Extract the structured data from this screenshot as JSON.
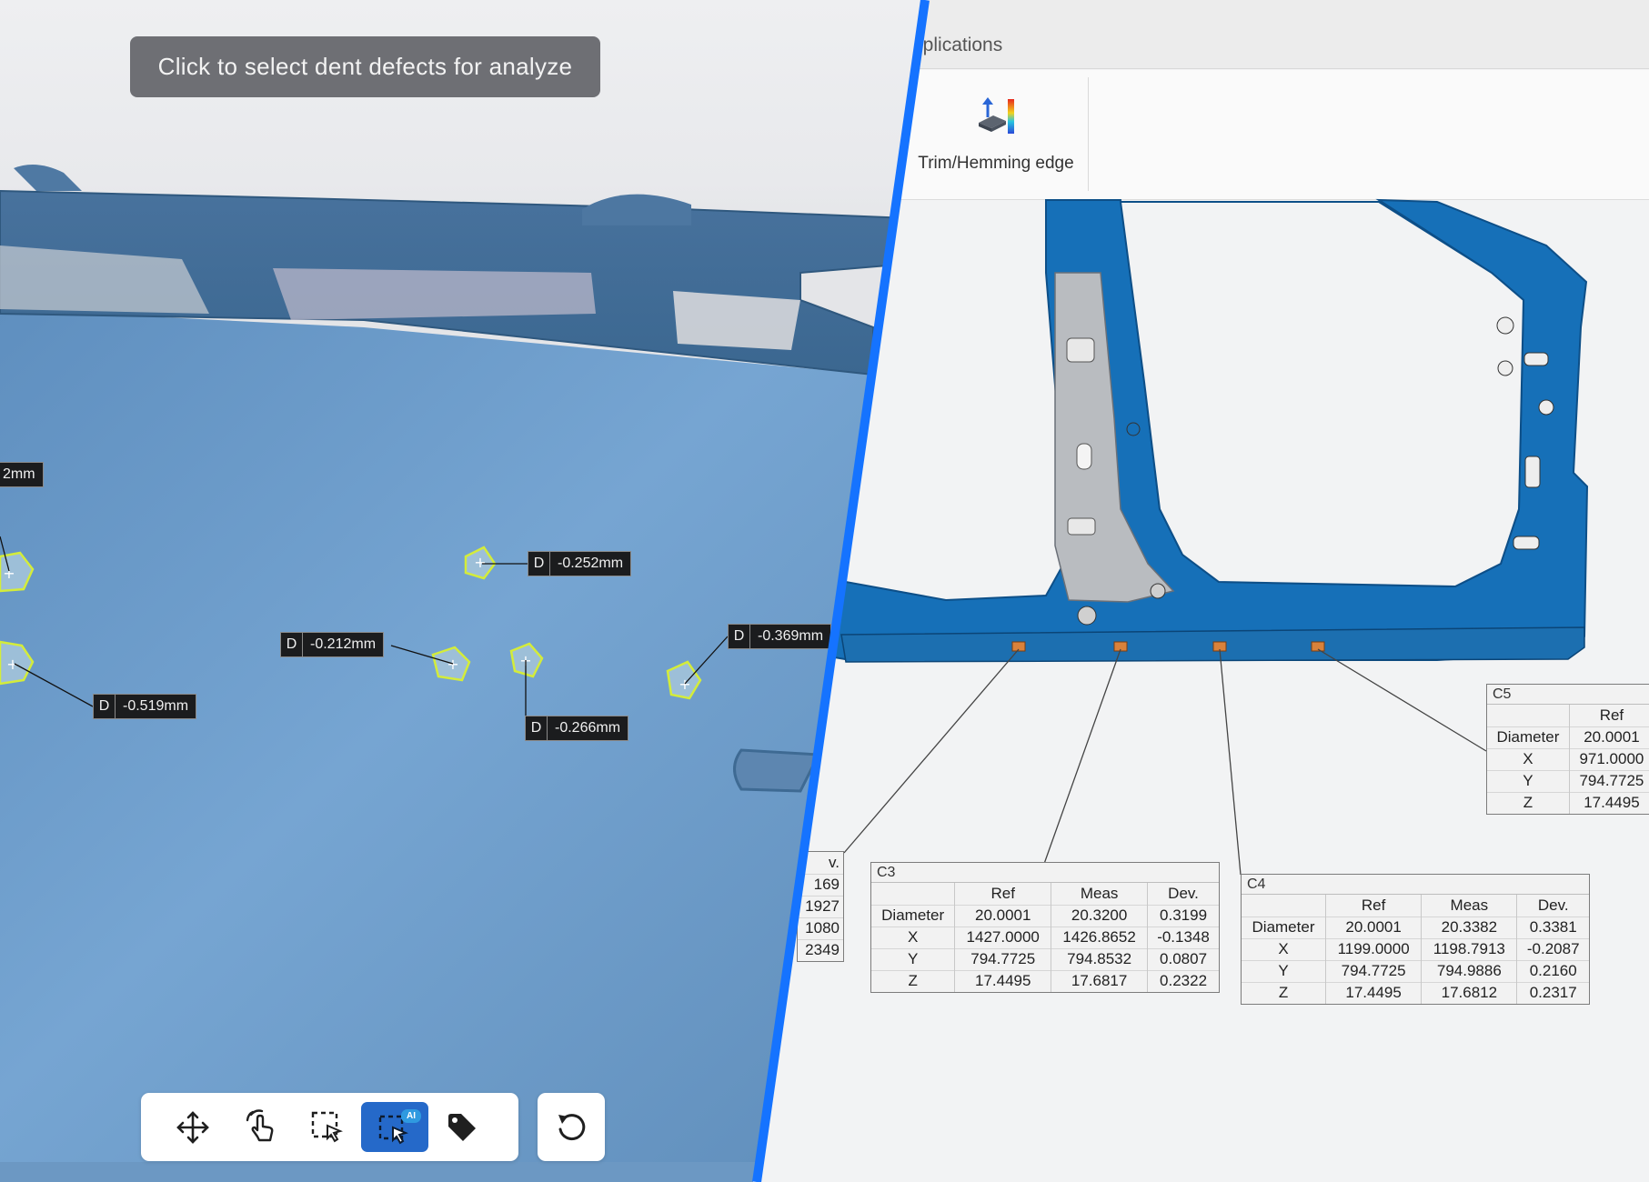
{
  "hint_tooltip": "Click to select dent defects for analyze",
  "ribbon": {
    "tab_label": "pplications",
    "tool_label": "Trim/Hemming edge"
  },
  "dent_labels": [
    {
      "key": "D",
      "value": "-0.252mm"
    },
    {
      "key": "D",
      "value": "-0.212mm"
    },
    {
      "key": "D",
      "value": "-0.369mm"
    },
    {
      "key": "D",
      "value": "-0.519mm"
    },
    {
      "key": "D",
      "value": "-0.266mm"
    },
    {
      "key": "",
      "value": "2mm"
    }
  ],
  "toolbar": {
    "tools": [
      {
        "icon": "move-icon",
        "active": false
      },
      {
        "icon": "touch-select-icon",
        "active": false
      },
      {
        "icon": "box-select-icon",
        "active": false
      },
      {
        "icon": "ai-select-icon",
        "active": true,
        "badge": "AI"
      },
      {
        "icon": "tag-icon",
        "active": false
      }
    ],
    "undo_icon": "undo-icon"
  },
  "tables": {
    "c3": {
      "name": "C3",
      "headers": [
        "",
        "Ref",
        "Meas",
        "Dev."
      ],
      "rows": [
        [
          "Diameter",
          "20.0001",
          "20.3200",
          "0.3199"
        ],
        [
          "X",
          "1427.0000",
          "1426.8652",
          "-0.1348"
        ],
        [
          "Y",
          "794.7725",
          "794.8532",
          "0.0807"
        ],
        [
          "Z",
          "17.4495",
          "17.6817",
          "0.2322"
        ]
      ]
    },
    "c4": {
      "name": "C4",
      "headers": [
        "",
        "Ref",
        "Meas",
        "Dev."
      ],
      "rows": [
        [
          "Diameter",
          "20.0001",
          "20.3382",
          "0.3381"
        ],
        [
          "X",
          "1199.0000",
          "1198.7913",
          "-0.2087"
        ],
        [
          "Y",
          "794.7725",
          "794.9886",
          "0.2160"
        ],
        [
          "Z",
          "17.4495",
          "17.6812",
          "0.2317"
        ]
      ]
    },
    "c5": {
      "name": "C5",
      "headers": [
        "",
        "Ref"
      ],
      "rows": [
        [
          "Diameter",
          "20.0001"
        ],
        [
          "X",
          "971.0000"
        ],
        [
          "Y",
          "794.7725"
        ],
        [
          "Z",
          "17.4495"
        ]
      ]
    },
    "c2_partial": {
      "header": "v.",
      "rows": [
        "169",
        "1927",
        "1080",
        "2349"
      ]
    }
  },
  "colors": {
    "divider": "#1573ff",
    "active_tool": "#2569c9",
    "body_part": "#1670b8",
    "door_surface": "#6f9cc9",
    "tooltip_bg": "#6e6f74"
  }
}
